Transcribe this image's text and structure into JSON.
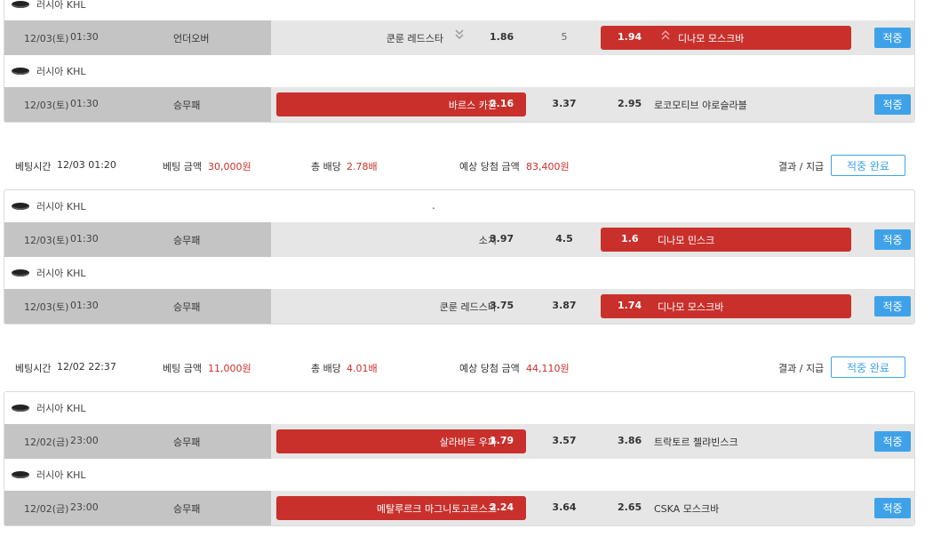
{
  "colors": {
    "accent_blue": "#3fa2e9",
    "pick_red": "#c9302c",
    "row_gray": "#e6e6e6",
    "left_gray": "#c4c4c4"
  },
  "league_icon": "hockey-puck-icon",
  "bet_top": {
    "games": [
      {
        "league": "러시아 KHL",
        "date": "12/03(토)",
        "time": "01:30",
        "type": "언더오버",
        "home": "쿤룬 레드스타",
        "home_odds": "1.86",
        "mid": "5",
        "away_odds": "1.94",
        "away": "디나모 모스크바",
        "home_arrow": "chevron-double-down-icon",
        "away_arrow": "chevron-double-up-icon",
        "hit": "적중"
      },
      {
        "league": "러시아 KHL",
        "date": "12/03(토)",
        "time": "01:30",
        "type": "승무패",
        "home": "바르스 카잔",
        "home_odds": "2.16",
        "mid": "3.37",
        "away_odds": "2.95",
        "away": "로코모티브 야로슬라블",
        "hit": "적중"
      }
    ]
  },
  "bet_1": {
    "summary": {
      "time_label": "베팅시간",
      "time": "12/03 01:20",
      "amount_label": "베팅 금액",
      "amount": "30,000원",
      "total_label": "총 배당",
      "total": "2.78배",
      "expected_label": "예상 당첨 금액",
      "expected": "83,400원",
      "result_label": "결과 / 지급",
      "status": "적중 완료"
    },
    "games": [
      {
        "league": "러시아 KHL",
        "dot": ".",
        "date": "12/03(토)",
        "time": "01:30",
        "type": "승무패",
        "home": "소치",
        "home_odds": "3.97",
        "mid": "4.5",
        "away_odds": "1.6",
        "away": "디나모 민스크",
        "hit": "적중"
      },
      {
        "league": "러시아 KHL",
        "date": "12/03(토)",
        "time": "01:30",
        "type": "승무패",
        "home": "쿤룬 레드스타",
        "home_odds": "3.75",
        "mid": "3.87",
        "away_odds": "1.74",
        "away": "디나모 모스크바",
        "hit": "적중"
      }
    ]
  },
  "bet_2": {
    "summary": {
      "time_label": "베팅시간",
      "time": "12/02 22:37",
      "amount_label": "베팅 금액",
      "amount": "11,000원",
      "total_label": "총 배당",
      "total": "4.01배",
      "expected_label": "예상 당첨 금액",
      "expected": "44,110원",
      "result_label": "결과 / 지급",
      "status": "적중 완료"
    },
    "games": [
      {
        "league": "러시아 KHL",
        "date": "12/02(금)",
        "time": "23:00",
        "type": "승무패",
        "home": "살라바트 우파",
        "home_odds": "1.79",
        "mid": "3.57",
        "away_odds": "3.86",
        "away": "트락토르 첼랴빈스크",
        "hit": "적중"
      },
      {
        "league": "러시아 KHL",
        "date": "12/02(금)",
        "time": "23:00",
        "type": "승무패",
        "home": "메탈루르크 마그니토고르스크",
        "home_odds": "2.24",
        "mid": "3.64",
        "away_odds": "2.65",
        "away": "CSKA 모스크바",
        "hit": "적중"
      }
    ]
  }
}
